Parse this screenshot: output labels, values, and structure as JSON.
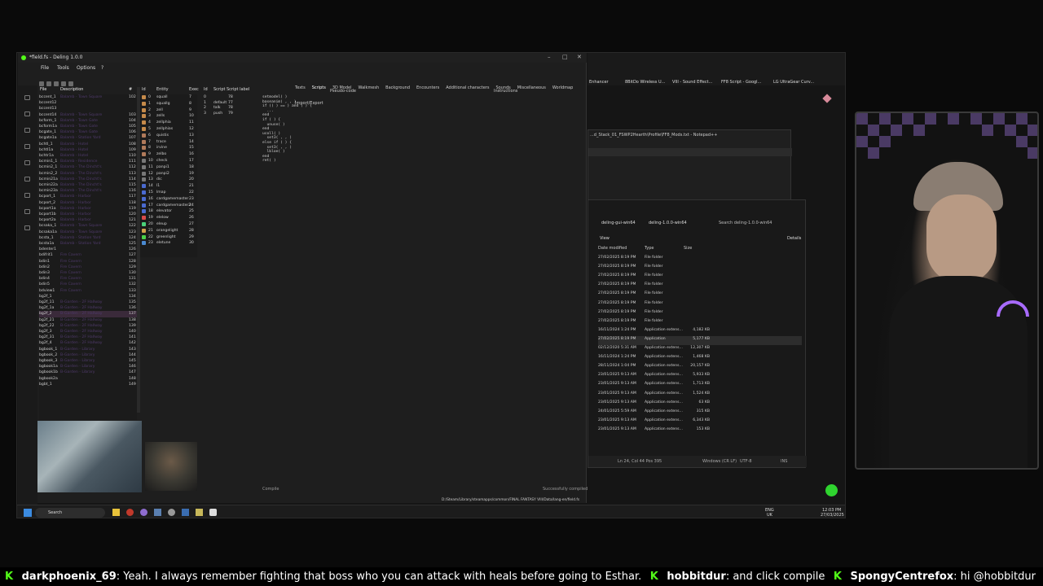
{
  "deling": {
    "title": "*field.fs - Deling 1.0.0",
    "menu": [
      "File",
      "Tools",
      "Options",
      "?"
    ],
    "list_headers": {
      "file": "File",
      "desc": "Description",
      "num": "#"
    },
    "entity_headers": {
      "id": "Id",
      "name": "Entity",
      "exec": "Exec"
    },
    "script_headers": {
      "id": "Id",
      "script": "Script",
      "label": "Script label"
    },
    "field_rows": [
      [
        "bccent_1",
        "Balamb - Town Square",
        "102"
      ],
      [
        "bccent12",
        "",
        ""
      ],
      [
        "bccent13",
        "",
        ""
      ],
      [
        "bccent14",
        "Balamb - Town Square",
        "103"
      ],
      [
        "bcform_1",
        "Balamb - Town Gate",
        "104"
      ],
      [
        "bcform1a",
        "Balamb - Town Gate",
        "105"
      ],
      [
        "bcgate_1",
        "Balamb - Town Gate",
        "106"
      ],
      [
        "bcgate1a",
        "Balamb - Station Yard",
        "107"
      ],
      [
        "bchtl_1",
        "Balamb - Hotel",
        "108"
      ],
      [
        "bchtl1a",
        "Balamb - Hotel",
        "109"
      ],
      [
        "bchtr1a",
        "Balamb - Hotel",
        "110"
      ],
      [
        "bcmin1_1",
        "Balamb - Residence",
        "111"
      ],
      [
        "bcmin2_1",
        "Balamb - The Dincht's",
        "112"
      ],
      [
        "bcmin2_2",
        "Balamb - The Dincht's",
        "113"
      ],
      [
        "bcmin21a",
        "Balamb - The Dincht's",
        "114"
      ],
      [
        "bcmin22a",
        "Balamb - The Dincht's",
        "115"
      ],
      [
        "bcmin23a",
        "Balamb - The Dincht's",
        "116"
      ],
      [
        "bcport_1",
        "Balamb - Harbor",
        "117"
      ],
      [
        "bcport_2",
        "Balamb - Harbor",
        "118"
      ],
      [
        "bcport1a",
        "Balamb - Harbor",
        "119"
      ],
      [
        "bcport1b",
        "Balamb - Harbor",
        "120"
      ],
      [
        "bcport2a",
        "Balamb - Harbor",
        "121"
      ],
      [
        "bcsaka_1",
        "Balamb - Town Square",
        "122"
      ],
      [
        "bcsaka1a",
        "Balamb - Town Square",
        "123"
      ],
      [
        "bcsta_1",
        "Balamb - Station Yard",
        "124"
      ],
      [
        "bcsta1a",
        "Balamb - Station Yard",
        "125"
      ],
      [
        "bdenter1",
        "",
        "126"
      ],
      [
        "bdifrit1",
        "Fire Cavern",
        "127"
      ],
      [
        "bdin1",
        "Fire Cavern",
        "128"
      ],
      [
        "bdin2",
        "Fire Cavern",
        "129"
      ],
      [
        "bdin3",
        "Fire Cavern",
        "130"
      ],
      [
        "bdin4",
        "Fire Cavern",
        "131"
      ],
      [
        "bdin5",
        "Fire Cavern",
        "132"
      ],
      [
        "bdview1",
        "Fire Cavern",
        "133"
      ],
      [
        "bg2f_1",
        "",
        "134"
      ],
      [
        "bg2f_11",
        "B-Garden - 2F Hallway",
        "135"
      ],
      [
        "bg2f_1a",
        "B-Garden - 2F Hallway",
        "136"
      ],
      [
        "bg2f_2",
        "B-Garden - 2F Hallway",
        "137"
      ],
      [
        "bg2f_21",
        "B-Garden - 2F Hallway",
        "138"
      ],
      [
        "bg2f_22",
        "B-Garden - 2F Hallway",
        "139"
      ],
      [
        "bg2f_3",
        "B-Garden - 2F Hallway",
        "140"
      ],
      [
        "bg2f_31",
        "B-Garden - 2F Hallway",
        "141"
      ],
      [
        "bg2f_4",
        "B-Garden - 2F Hallway",
        "142"
      ],
      [
        "bgbook_1",
        "B-Garden - Library",
        "143"
      ],
      [
        "bgbook_2",
        "B-Garden - Library",
        "144"
      ],
      [
        "bgbook_3",
        "B-Garden - Library",
        "145"
      ],
      [
        "bgbook1a",
        "B-Garden - Library",
        "146"
      ],
      [
        "bgbook1b",
        "B-Garden - Library",
        "147"
      ],
      [
        "bgbook2a",
        "",
        "148"
      ],
      [
        "bgbt_1",
        "",
        "149"
      ]
    ],
    "entity_rows": [
      [
        "0",
        "squall",
        "7"
      ],
      [
        "1",
        "squallg",
        "8"
      ],
      [
        "2",
        "zell",
        "9"
      ],
      [
        "3",
        "zells",
        "10"
      ],
      [
        "4",
        "zellphia",
        "11"
      ],
      [
        "5",
        "zellphias",
        "12"
      ],
      [
        "6",
        "quistis",
        "13"
      ],
      [
        "7",
        "trace",
        "14"
      ],
      [
        "8",
        "irvine",
        "15"
      ],
      [
        "9",
        "zelbo",
        "16"
      ],
      [
        "10",
        "check",
        "17"
      ],
      [
        "11",
        "panpi1",
        "18"
      ],
      [
        "12",
        "panpi2",
        "19"
      ],
      [
        "13",
        "dic",
        "20"
      ],
      [
        "14",
        "l1",
        "21"
      ],
      [
        "15",
        "lmap",
        "22"
      ],
      [
        "16",
        "cardgamemaster",
        "23"
      ],
      [
        "17",
        "cardgamemaster2",
        "24"
      ],
      [
        "18",
        "elevator",
        "25"
      ],
      [
        "19",
        "elelow",
        "26"
      ],
      [
        "20",
        "eleup",
        "27"
      ],
      [
        "21",
        "orangelight",
        "28"
      ],
      [
        "22",
        "greenlight",
        "29"
      ],
      [
        "23",
        "eletune",
        "30"
      ]
    ],
    "script_rows": [
      [
        "0",
        "",
        "78"
      ],
      [
        "1",
        "default",
        "77"
      ],
      [
        "2",
        "talk",
        "78"
      ],
      [
        "3",
        "push",
        "79"
      ]
    ],
    "tabs": [
      "Texts",
      "Scripts",
      "3D Model",
      "Walkmesh",
      "Background",
      "Encounters",
      "Additional characters",
      "Sounds",
      "Miscellaneous",
      "Worldmap",
      "Import/Export"
    ],
    "pseudo_code_label": "Pseudo-code",
    "instructions_label": "Instructions",
    "code_lines": [
      "setmodel( )",
      "baseanim( , , )",
      "if (( ) == ) and ( ) {",
      "  ...",
      "end",
      "if ( ) {",
      "  unuse( )",
      "end",
      "ucoll( )",
      "  set3( , , )",
      "else if ( ) {",
      "  set3( , , )",
      "  lbloe( )",
      "end",
      "ret( )"
    ],
    "compile_label": "Compile",
    "status": "Successfully compiled",
    "path": "D:/Steam/Library/steamapps/common/FINAL FANTASY VIII/Data/lang-en/field.fs"
  },
  "browser": {
    "bookmarks": [
      "Enhancer",
      "8BitDo Wireless U...",
      "VIII - Sound Effect...",
      "FF8 Script - Googl...",
      "LG UltraGear Curv..."
    ]
  },
  "notepad": {
    "title": "...d_Stack_01_FSWP2Hearth\\Profile\\FF8_Mods.txt - Notepad++",
    "status_left": "Ln 24, Col 44  Pos 395",
    "status_mid": "Windows (CR LF)",
    "status_enc": "UTF-8",
    "status_ins": "INS"
  },
  "explorer": {
    "crumbs": [
      "deling-gui-win64",
      "deling-1.0.0-win64"
    ],
    "search_placeholder": "Search deling-1.0.0-win64",
    "view_label": "View",
    "details_label": "Details",
    "headers": {
      "date": "Date modified",
      "type": "Type",
      "size": "Size"
    },
    "rows": [
      [
        "27/02/2025 8:19 PM",
        "File folder",
        ""
      ],
      [
        "27/02/2025 8:19 PM",
        "File folder",
        ""
      ],
      [
        "27/02/2025 8:19 PM",
        "File folder",
        ""
      ],
      [
        "27/02/2025 8:19 PM",
        "File folder",
        ""
      ],
      [
        "27/02/2025 8:19 PM",
        "File folder",
        ""
      ],
      [
        "27/02/2025 8:19 PM",
        "File folder",
        ""
      ],
      [
        "27/02/2025 8:19 PM",
        "File folder",
        ""
      ],
      [
        "27/02/2025 8:19 PM",
        "File folder",
        ""
      ],
      [
        "16/11/2024 1:24 PM",
        "Application extens...",
        "4,182 KB"
      ],
      [
        "27/02/2025 8:19 PM",
        "Application",
        "5,177 KB"
      ],
      [
        "02/12/2020 5:31 AM",
        "Application extens...",
        "12,307 KB"
      ],
      [
        "16/11/2024 1:24 PM",
        "Application extens...",
        "1,468 KB"
      ],
      [
        "28/11/2024 1:04 PM",
        "Application extens...",
        "20,157 KB"
      ],
      [
        "23/01/2025 9:13 AM",
        "Application extens...",
        "5,933 KB"
      ],
      [
        "23/01/2025 9:13 AM",
        "Application extens...",
        "1,713 KB"
      ],
      [
        "23/01/2025 9:13 AM",
        "Application extens...",
        "1,524 KB"
      ],
      [
        "23/01/2025 9:13 AM",
        "Application extens...",
        "63 KB"
      ],
      [
        "24/01/2025 5:59 AM",
        "Application extens...",
        "315 KB"
      ],
      [
        "23/01/2025 9:13 AM",
        "Application extens...",
        "6,343 KB"
      ],
      [
        "23/01/2025 9:13 AM",
        "Application extens...",
        "153 KB"
      ]
    ]
  },
  "taskbar": {
    "search_placeholder": "Search",
    "lang_1": "ENG",
    "lang_2": "UK",
    "time": "12:03 PM",
    "date": "27/03/2025"
  },
  "chat": {
    "messages": [
      {
        "user": "darkphoenix_69",
        "text": ": Yeah. I always remember fighting that boss who you can attack with heals before going to Esthar."
      },
      {
        "user": "hobbitdur",
        "text": ": and click compile"
      },
      {
        "user": "SpongyCentrefox",
        "text": ": hi @hobbitdur"
      }
    ],
    "kick_icon": "kick-logo-icon"
  },
  "colors": {
    "accent": "#53fc18",
    "description_text": "#4f3a6b"
  }
}
